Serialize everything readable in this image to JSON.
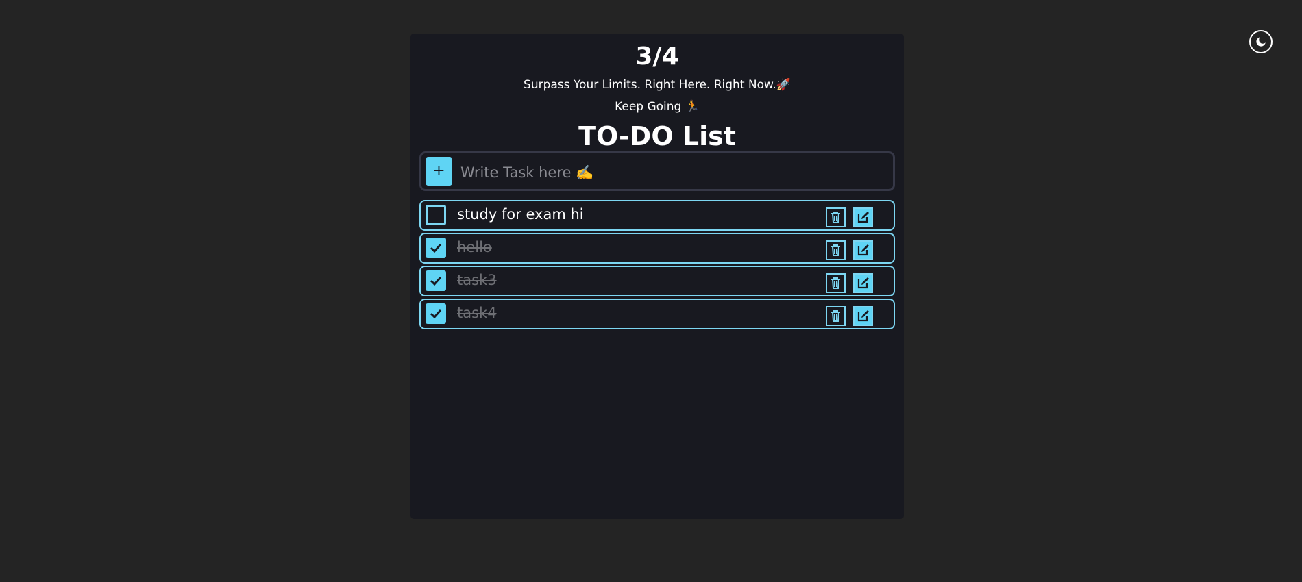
{
  "header": {
    "progress": "3/4",
    "tagline": "Surpass Your Limits. Right Here. Right Now.🚀",
    "encouragement": "Keep Going 🏃",
    "title": "TO-DO List"
  },
  "add_task": {
    "button_label": "+",
    "placeholder": "Write Task here ✍️"
  },
  "tasks": [
    {
      "text": "study for exam hi",
      "completed": false
    },
    {
      "text": "hello",
      "completed": true
    },
    {
      "text": "task3",
      "completed": true
    },
    {
      "text": "task4",
      "completed": true
    }
  ],
  "colors": {
    "page_background": "#242424",
    "card_background": "#181920",
    "accent": "#5fd4f4",
    "border_accent": "#7dd6f2",
    "completed_text": "#6e6f74"
  },
  "icons": {
    "theme_toggle": "moon-icon",
    "add": "plus-icon",
    "delete": "trash-icon",
    "edit": "edit-icon",
    "checked": "check-icon"
  }
}
